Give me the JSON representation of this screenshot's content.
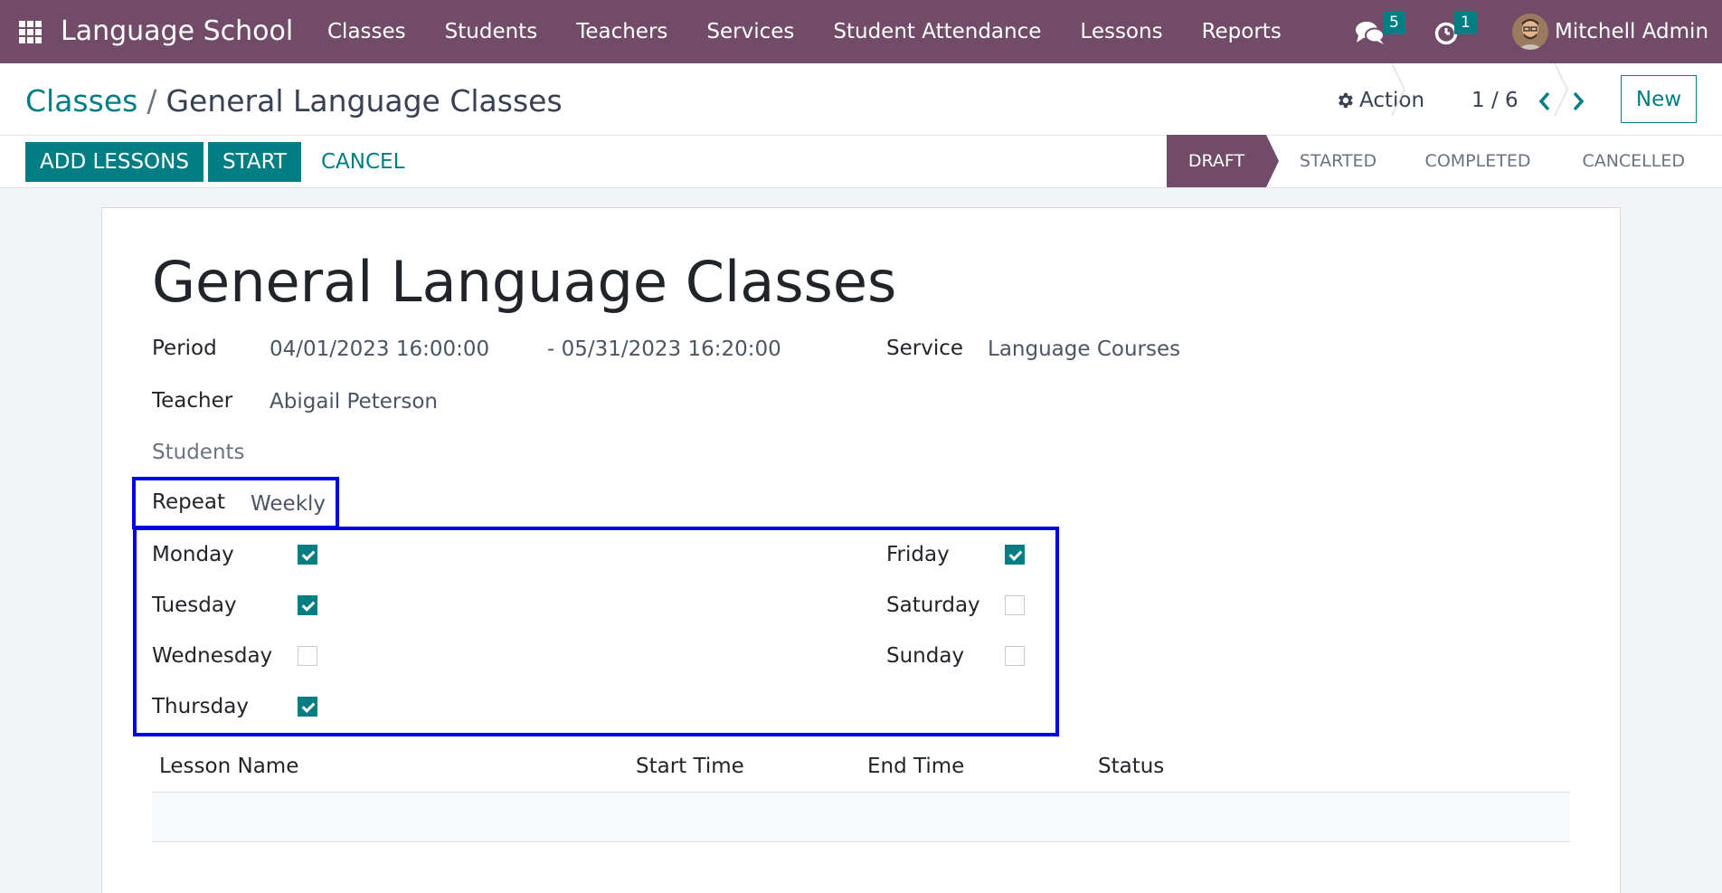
{
  "navbar": {
    "brand": "Language School",
    "menu": [
      "Classes",
      "Students",
      "Teachers",
      "Services",
      "Student Attendance",
      "Lessons",
      "Reports"
    ],
    "messages_count": "5",
    "activities_count": "1",
    "user_name": "Mitchell Admin",
    "bg_color": "#714b67",
    "badge_color": "#017e84"
  },
  "breadcrumb": {
    "parent": "Classes",
    "separator": "/",
    "current": "General Language Classes"
  },
  "control": {
    "action_label": "Action",
    "pager": "1 / 6",
    "new_label": "New"
  },
  "buttons": {
    "add_lessons": "ADD LESSONS",
    "start": "START",
    "cancel": "CANCEL"
  },
  "statusbar": {
    "stages": [
      "DRAFT",
      "STARTED",
      "COMPLETED",
      "CANCELLED"
    ],
    "active": "DRAFT"
  },
  "form": {
    "title": "General Language Classes",
    "period_label": "Period",
    "period_start": "04/01/2023 16:00:00",
    "period_end": "- 05/31/2023 16:20:00",
    "service_label": "Service",
    "service_value": "Language Courses",
    "teacher_label": "Teacher",
    "teacher_value": "Abigail Peterson",
    "students_label": "Students",
    "repeat_label": "Repeat",
    "repeat_value": "Weekly",
    "days": {
      "monday": {
        "label": "Monday",
        "checked": true
      },
      "tuesday": {
        "label": "Tuesday",
        "checked": true
      },
      "wednesday": {
        "label": "Wednesday",
        "checked": false
      },
      "thursday": {
        "label": "Thursday",
        "checked": true
      },
      "friday": {
        "label": "Friday",
        "checked": true
      },
      "saturday": {
        "label": "Saturday",
        "checked": false
      },
      "sunday": {
        "label": "Sunday",
        "checked": false
      }
    }
  },
  "lessons_table": {
    "columns": [
      "Lesson Name",
      "Start Time",
      "End Time",
      "Status"
    ],
    "rows": []
  },
  "highlight_color": "#0000e6"
}
